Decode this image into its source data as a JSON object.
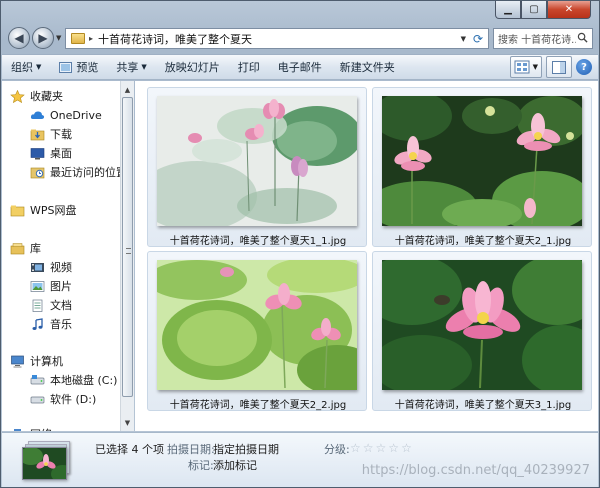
{
  "window": {
    "caption_buttons": {
      "minimize": "▁",
      "maximize": "▢",
      "close": "✕"
    }
  },
  "address_bar": {
    "separator": "▸",
    "path": "十首荷花诗词，唯美了整个夏天",
    "search_placeholder": "搜索 十首荷花诗..."
  },
  "toolbar": {
    "items": [
      {
        "label": "组织",
        "dropdown": true,
        "icon": ""
      },
      {
        "label": "预览",
        "dropdown": false,
        "icon": "preview-icon"
      },
      {
        "label": "共享",
        "dropdown": true,
        "icon": ""
      },
      {
        "label": "放映幻灯片",
        "dropdown": false,
        "icon": ""
      },
      {
        "label": "打印",
        "dropdown": false,
        "icon": ""
      },
      {
        "label": "电子邮件",
        "dropdown": false,
        "icon": ""
      },
      {
        "label": "新建文件夹",
        "dropdown": false,
        "icon": ""
      }
    ],
    "help_label": "?"
  },
  "nav_pane": {
    "items": [
      {
        "label": "收藏夹",
        "icon": "star-icon",
        "level": 0
      },
      {
        "label": "OneDrive",
        "icon": "cloud-icon",
        "level": 1
      },
      {
        "label": "下载",
        "icon": "download-folder-icon",
        "level": 1
      },
      {
        "label": "桌面",
        "icon": "desktop-icon",
        "level": 1
      },
      {
        "label": "最近访问的位置",
        "icon": "recent-places-icon",
        "level": 1
      },
      {
        "label": "WPS网盘",
        "icon": "folder-icon",
        "level": 0
      },
      {
        "label": "库",
        "icon": "library-icon",
        "level": 0
      },
      {
        "label": "视频",
        "icon": "video-icon",
        "level": 1
      },
      {
        "label": "图片",
        "icon": "pictures-icon",
        "level": 1
      },
      {
        "label": "文档",
        "icon": "documents-icon",
        "level": 1
      },
      {
        "label": "音乐",
        "icon": "music-icon",
        "level": 1
      },
      {
        "label": "计算机",
        "icon": "computer-icon",
        "level": 0
      },
      {
        "label": "本地磁盘 (C:)",
        "icon": "drive-icon",
        "level": 1
      },
      {
        "label": "软件 (D:)",
        "icon": "drive-icon",
        "level": 1
      },
      {
        "label": "网络",
        "icon": "network-icon",
        "level": 0
      }
    ]
  },
  "files": [
    {
      "name": "十首荷花诗词，唯美了整个夏天1_1.jpg",
      "selected": true
    },
    {
      "name": "十首荷花诗词，唯美了整个夏天2_1.jpg",
      "selected": true
    },
    {
      "name": "十首荷花诗词，唯美了整个夏天2_2.jpg",
      "selected": true
    },
    {
      "name": "十首荷花诗词，唯美了整个夏天3_1.jpg",
      "selected": true
    }
  ],
  "details": {
    "selection": "已选择 4 个项",
    "date_label": "拍摄日期:",
    "date_value": "指定拍摄日期",
    "tags_label": "标记:",
    "tags_value": "添加标记",
    "rating_label": "分级:",
    "rating_value": 0,
    "rating_max": 5,
    "watermark": "https://blog.csdn.net/qq_40239927"
  },
  "colors": {
    "selection_tile": "#e2eaf3",
    "window_frame": "#b9c8d8",
    "lotus_pink": "#f07fb0"
  }
}
